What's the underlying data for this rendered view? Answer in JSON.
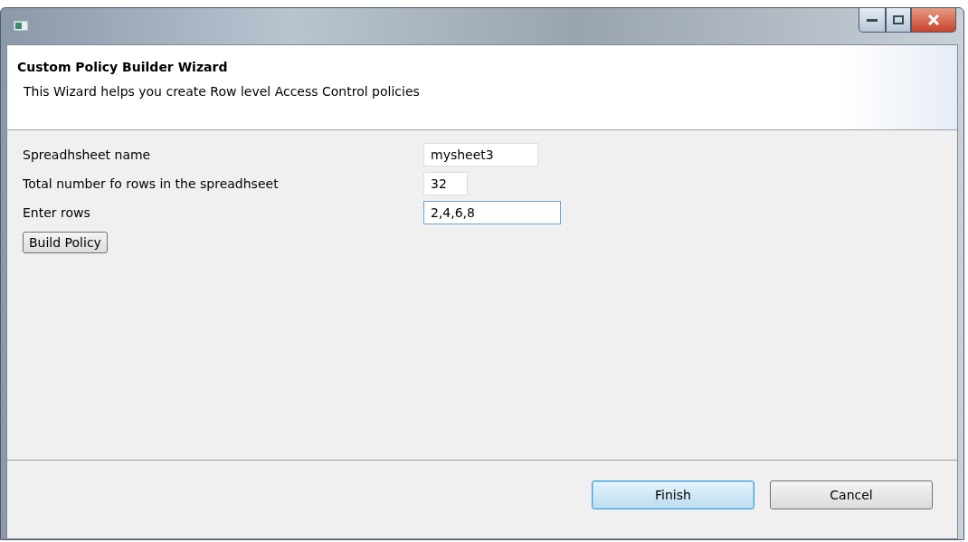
{
  "header": {
    "title": "Custom Policy Builder Wizard",
    "description": "This Wizard helps you create Row level Access Control policies"
  },
  "fields": [
    {
      "label": "Spreadhsheet name",
      "value": "mysheet3",
      "focused": false
    },
    {
      "label": "Total number fo rows in the spreadhseet",
      "value": "32",
      "focused": false
    },
    {
      "label": "Enter rows",
      "value": "2,4,6,8",
      "focused": true
    }
  ],
  "action_button": "Build Policy",
  "buttons": [
    {
      "label": "Finish",
      "default": true
    },
    {
      "label": "Cancel",
      "default": false
    }
  ]
}
